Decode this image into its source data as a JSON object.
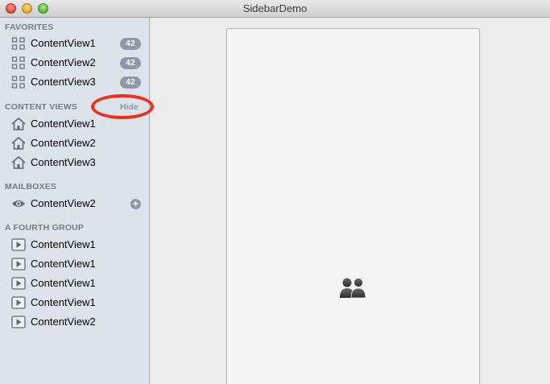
{
  "window": {
    "title": "SidebarDemo"
  },
  "sidebar": {
    "groups": [
      {
        "header": "FAVORITES",
        "items": [
          {
            "label": "ContentView1",
            "icon": "grid-icon",
            "badge": "42"
          },
          {
            "label": "ContentView2",
            "icon": "grid-icon",
            "badge": "42"
          },
          {
            "label": "ContentView3",
            "icon": "grid-icon",
            "badge": "42"
          }
        ]
      },
      {
        "header": "CONTENT VIEWS",
        "action": "Hide",
        "items": [
          {
            "label": "ContentView1",
            "icon": "house-icon"
          },
          {
            "label": "ContentView2",
            "icon": "house-icon"
          },
          {
            "label": "ContentView3",
            "icon": "house-icon"
          }
        ]
      },
      {
        "header": "MAILBOXES",
        "items": [
          {
            "label": "ContentView2",
            "icon": "eye-icon",
            "action_icon": "plus-icon"
          }
        ]
      },
      {
        "header": "A FOURTH GROUP",
        "items": [
          {
            "label": "ContentView1",
            "icon": "play-icon"
          },
          {
            "label": "ContentView1",
            "icon": "play-icon"
          },
          {
            "label": "ContentView1",
            "icon": "play-icon"
          },
          {
            "label": "ContentView1",
            "icon": "play-icon"
          },
          {
            "label": "ContentView2",
            "icon": "play-icon"
          }
        ]
      }
    ]
  },
  "main": {
    "icon": "people-icon"
  },
  "colors": {
    "sidebar_bg": "#dde3eb",
    "badge_bg": "#8e98a6",
    "annotation_ring": "#f22d1a",
    "header_text": "#6f7782"
  }
}
